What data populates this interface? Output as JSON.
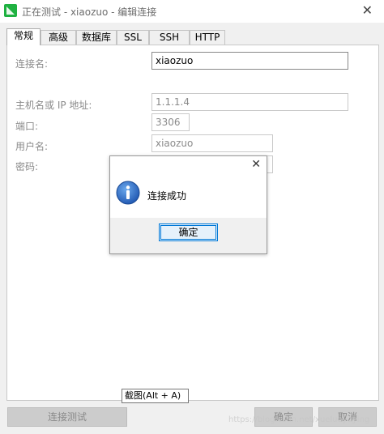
{
  "window": {
    "title": "正在测试 - xiaozuo - 编辑连接",
    "accent_color": "#1fb141"
  },
  "tabs": [
    {
      "label": "常规",
      "active": true
    },
    {
      "label": "高级",
      "active": false
    },
    {
      "label": "数据库",
      "active": false
    },
    {
      "label": "SSL",
      "active": false
    },
    {
      "label": "SSH",
      "active": false
    },
    {
      "label": "HTTP",
      "active": false
    }
  ],
  "form": {
    "connection_name": {
      "label": "连接名:",
      "value": "xiaozuo"
    },
    "host": {
      "label": "主机名或 IP 地址:",
      "value": "1.1.1.4"
    },
    "port": {
      "label": "端口:",
      "value": "3306"
    },
    "user": {
      "label": "用户名:",
      "value": "xiaozuo"
    },
    "password": {
      "label": "密码:",
      "value": ""
    }
  },
  "footer": {
    "test_button": "连接测试",
    "ok_button": "确定",
    "cancel_button": "取消",
    "tooltip": "截图(Alt + A)",
    "watermark": "https://blog.csdn.net/xueluoyuying"
  },
  "dialog": {
    "message": "连接成功",
    "ok_button": "确定",
    "icon": "info-icon"
  }
}
